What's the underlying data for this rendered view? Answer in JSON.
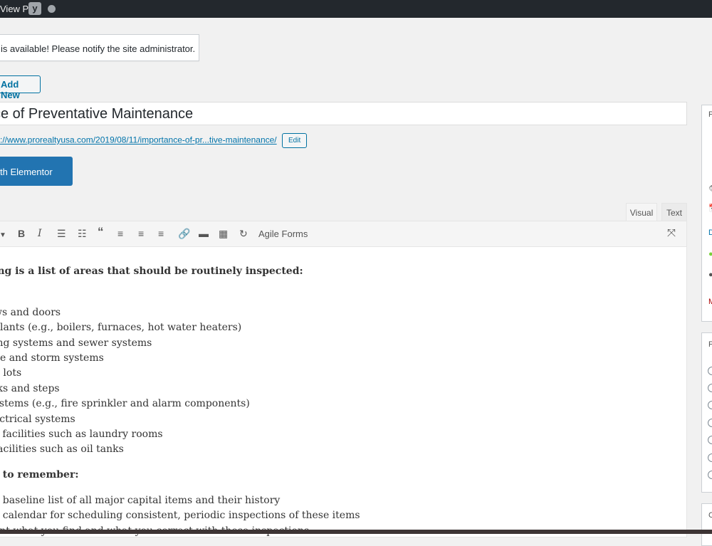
{
  "adminbar": {
    "view_post": "View Post",
    "yoast_letter": "y"
  },
  "notice": {
    "text": "is available! Please notify the site administrator."
  },
  "add_new": "Add New",
  "title": "ce of Preventative Maintenance",
  "permalink": {
    "url": "://www.prorealtyusa.com/2019/08/11/importance-of-pr...tive-maintenance/",
    "edit": "Edit"
  },
  "elementor": "th Elementor",
  "tabs": {
    "visual": "Visual",
    "text": "Text"
  },
  "toolbar": {
    "bold": "B",
    "italic": "I",
    "agile": "Agile Forms"
  },
  "content": {
    "heading": "ing is a list of areas that should be routinely inspected:",
    "items": [
      "ws and doors",
      "plants (e.g., boilers, furnaces, hot water heaters)",
      "ing systems and sewer systems",
      "ge and storm systems",
      "g lots",
      "lks and steps",
      "ystems (e.g., fire sprinkler and alarm components)",
      "ectrical systems",
      "y facilities such as laundry rooms",
      " facilities such as oil tanks"
    ],
    "heading2": "s to remember:",
    "items2": [
      "a baseline list of all major capital items and their history",
      "a calendar for scheduling consistent, periodic inspections of these items",
      "ent what you find and what you correct with these inspections"
    ]
  },
  "sidebar": {
    "p1": "P",
    "p2": "F",
    "p3": "C",
    "d": "D",
    "m": "M"
  }
}
